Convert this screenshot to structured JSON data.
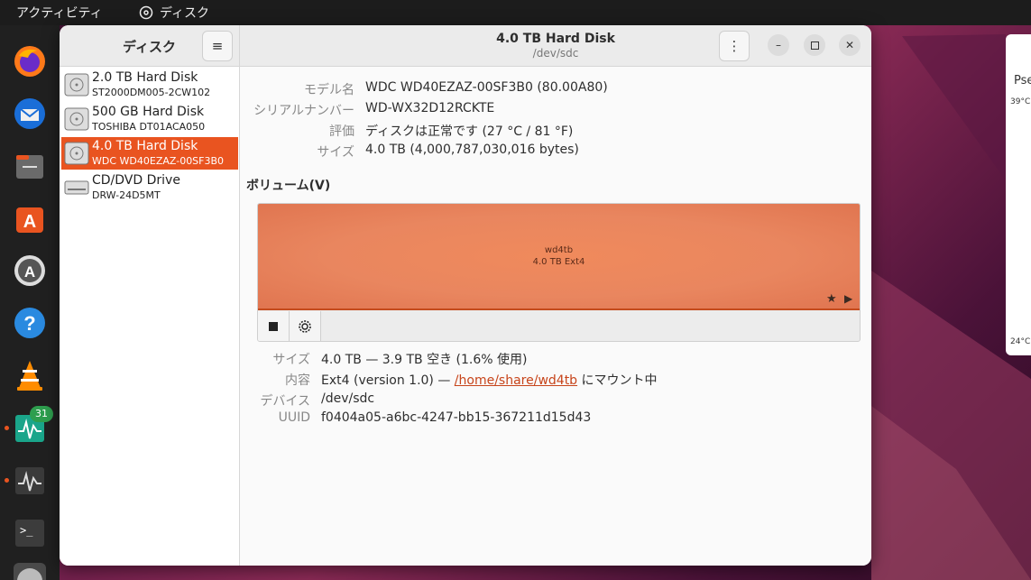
{
  "topbar": {
    "activities": "アクティビティ",
    "app_name": "ディスク"
  },
  "dock": {
    "badge_count": "31"
  },
  "window": {
    "sidebar_title": "ディスク",
    "title": "4.0 TB Hard Disk",
    "subtitle": "/dev/sdc"
  },
  "drives": [
    {
      "name": "2.0 TB Hard Disk",
      "model": "ST2000DM005-2CW102"
    },
    {
      "name": "500 GB Hard Disk",
      "model": "TOSHIBA DT01ACA050"
    },
    {
      "name": "4.0 TB Hard Disk",
      "model": "WDC WD40EZAZ-00SF3B0"
    },
    {
      "name": "CD/DVD Drive",
      "model": "DRW-24D5MT"
    }
  ],
  "disk_info": {
    "model_label": "モデル名",
    "model_value": "WDC WD40EZAZ-00SF3B0 (80.00A80)",
    "serial_label": "シリアルナンバー",
    "serial_value": "WD-WX32D12RCKTE",
    "assessment_label": "評価",
    "assessment_value": "ディスクは正常です (27 °C / 81 °F)",
    "size_label": "サイズ",
    "size_value": "4.0 TB (4,000,787,030,016 bytes)"
  },
  "volumes": {
    "section_title": "ボリューム(V)",
    "partition_name": "wd4tb",
    "partition_size": "4.0 TB Ext4"
  },
  "volume_info": {
    "size_label": "サイズ",
    "size_value": "4.0 TB — 3.9 TB 空き (1.6% 使用)",
    "contents_label": "内容",
    "contents_prefix": "Ext4 (version 1.0) — ",
    "mount_link": "/home/share/wd4tb",
    "contents_suffix": " にマウント中",
    "device_label": "デバイス",
    "device_value": "/dev/sdc",
    "uuid_label": "UUID",
    "uuid_value": "f0404a05-a6bc-4247-bb15-367211d15d43"
  },
  "right_panel": {
    "label": "Pse",
    "temp_high": "39°C",
    "temp_low": "24°C"
  }
}
